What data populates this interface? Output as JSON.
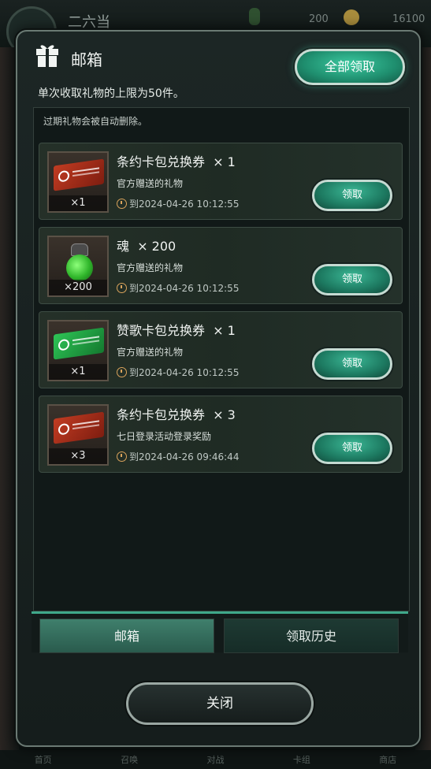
{
  "background": {
    "player_name": "二六当",
    "stat_1": "200",
    "stat_2": "16100",
    "nav": [
      "首页",
      "召唤",
      "对战",
      "卡组",
      "商店"
    ]
  },
  "dialog": {
    "title": "邮箱",
    "claim_all_label": "全部领取",
    "limit_text": "单次收取礼物的上限为50件。",
    "expire_note": "过期礼物会被自动删除。",
    "items": [
      {
        "name": "条约卡包兑换券",
        "qty": "× 1",
        "source": "官方赠送的礼物",
        "time": "到2024-04-26  10:12:55",
        "thumb_count": "×1",
        "icon": "red-ticket-icon",
        "claim_label": "领取"
      },
      {
        "name": "魂",
        "qty": "× 200",
        "source": "官方赠送的礼物",
        "time": "到2024-04-26  10:12:55",
        "thumb_count": "×200",
        "icon": "soul-bottle-icon",
        "claim_label": "领取"
      },
      {
        "name": "赞歌卡包兑换券",
        "qty": "× 1",
        "source": "官方赠送的礼物",
        "time": "到2024-04-26  10:12:55",
        "thumb_count": "×1",
        "icon": "green-ticket-icon",
        "claim_label": "领取"
      },
      {
        "name": "条约卡包兑换券",
        "qty": "× 3",
        "source": "七日登录活动登录奖励",
        "time": "到2024-04-26  09:46:44",
        "thumb_count": "×3",
        "icon": "red-ticket-icon",
        "claim_label": "领取"
      }
    ],
    "tabs": [
      "邮箱",
      "领取历史"
    ],
    "close_label": "关闭"
  },
  "colors": {
    "accent": "#2fa37f",
    "panel": "#151d1c"
  }
}
